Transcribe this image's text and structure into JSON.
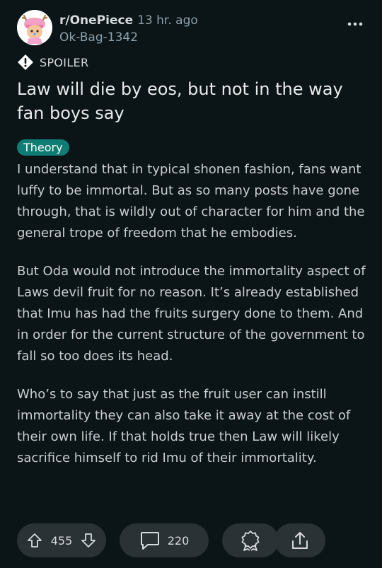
{
  "post": {
    "subreddit": "r/OnePiece",
    "time": "13 hr. ago",
    "username": "Ok-Bag-1342",
    "spoiler_label": "SPOILER",
    "title": "Law will die by eos, but not in the way fan boys say",
    "flair": "Theory",
    "paragraphs": [
      "I understand that in typical shonen fashion, fans want luffy to be immortal. But as so many posts have gone through, that is wildly out of character for him and the general trope of freedom that he embodies.",
      "But Oda would not introduce the immortality aspect of Laws devil fruit for no reason. It’s already established that Imu has had the fruits surgery done to them. And in order for the current structure of the government to fall so too does its head.",
      "Who’s to say that just as the fruit user can instill immortality they can also take it away at the cost of their own life. If that holds true then Law will likely sacrifice himself to rid Imu of their immortality."
    ]
  },
  "actions": {
    "vote_count": "455",
    "comment_count": "220"
  },
  "icons": {
    "avatar": "chopper-avatar-icon",
    "more": "more-dots-icon",
    "spoiler": "spoiler-warning-icon",
    "upvote": "upvote-arrow-icon",
    "downvote": "downvote-arrow-icon",
    "comment": "comment-bubble-icon",
    "award": "award-ribbon-icon",
    "share": "share-icon"
  },
  "colors": {
    "background": "#0b1416",
    "flair": "#0f7d74",
    "pill": "#2a3236",
    "text": "#d7dadc",
    "muted": "#8ba2ad"
  }
}
